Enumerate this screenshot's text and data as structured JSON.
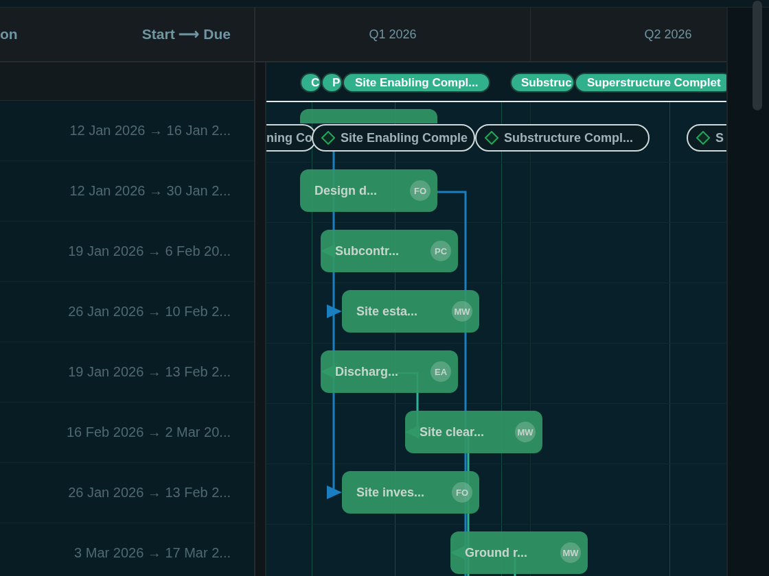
{
  "columns": [
    {
      "label": "on"
    },
    {
      "label": "Start ⟶ Due"
    }
  ],
  "quarters": [
    "Q1 2026",
    "Q2 2026"
  ],
  "milestone_chips": [
    "C",
    "P",
    "Site Enabling Compl...",
    "Substruc",
    "Superstructure Complet"
  ],
  "milestone_pills": [
    {
      "label": "ning Co",
      "icon": false
    },
    {
      "label": "Site Enabling Comple",
      "icon": true
    },
    {
      "label": "Substructure Compl...",
      "icon": true
    },
    {
      "label": "S",
      "icon": true
    }
  ],
  "rows": [
    {
      "dates": "12 Jan 2026 → 16 Jan 2...",
      "bar": {}
    },
    {
      "dates": "12 Jan 2026 → 30 Jan 2...",
      "bar": {
        "label": "Design d...",
        "initials": "FO"
      }
    },
    {
      "dates": "19 Jan 2026 → 6 Feb 20...",
      "bar": {
        "label": "Subcontr...",
        "initials": "PC"
      }
    },
    {
      "dates": "26 Jan 2026 → 10 Feb 2...",
      "bar": {
        "label": "Site esta...",
        "initials": "MW"
      }
    },
    {
      "dates": "19 Jan 2026 → 13 Feb 2...",
      "bar": {
        "label": "Discharg...",
        "initials": "EA"
      }
    },
    {
      "dates": "16 Feb 2026 → 2 Mar 20...",
      "bar": {
        "label": "Site clear...",
        "initials": "MW"
      }
    },
    {
      "dates": "26 Jan 2026 → 13 Feb 2...",
      "bar": {
        "label": "Site inves...",
        "initials": "FO"
      }
    },
    {
      "dates": "3 Mar 2026 → 17 Mar 2...",
      "bar": {
        "label": "Ground r...",
        "initials": "MW"
      }
    }
  ]
}
